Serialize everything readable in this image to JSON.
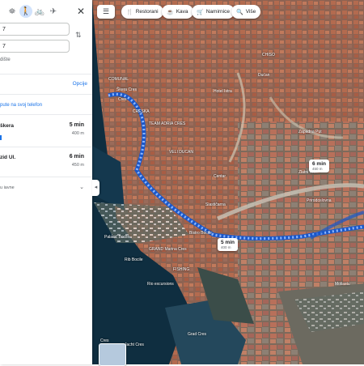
{
  "panel": {
    "modes": [
      {
        "name": "best-icon",
        "glyph": "⛯"
      },
      {
        "name": "walk-icon",
        "glyph": "🚶"
      },
      {
        "name": "bike-icon",
        "glyph": "🚲"
      },
      {
        "name": "flight-icon",
        "glyph": "✈"
      }
    ],
    "close_glyph": "✕",
    "origin_value": "7",
    "destination_value": "7",
    "swap_glyph": "⇅",
    "add_destination": "dište",
    "options_label": "Opcije",
    "send_to_phone": "pute na svoj telefon",
    "routes": [
      {
        "name": "škera",
        "time": "5 min",
        "distance": "400 m"
      },
      {
        "name": "zid Ul.",
        "time": "6 min",
        "distance": "450 m"
      }
    ],
    "footer_text": "u iavne",
    "footer_chevron": "⌄",
    "collapse_glyph": "◂"
  },
  "map": {
    "menu_glyph": "☰",
    "chips": [
      {
        "icon": "🍴",
        "label": "Restorani"
      },
      {
        "icon": "☕",
        "label": "Kava"
      },
      {
        "icon": "🛒",
        "label": "Namirnice"
      },
      {
        "icon": "🔍",
        "label": "Više"
      }
    ],
    "labels": [
      "COMUNAL",
      "Cres",
      "TEAM ADRIA CRES",
      "CHISO",
      "Dućan",
      "CRESKA",
      "Škera Cres",
      "Hotel Istra",
      "VELI DUCAN",
      "Palacić Bocile",
      "GRAND Marina Cres",
      "Bistro Bocile",
      "Slastičarna",
      "Zlatni Kafe",
      "Rib Bocile",
      "Rio excursions",
      "FISHING",
      "Grad Cres",
      "Jacht Cres",
      "Cres",
      "Moliastu",
      "Prirodoslovna",
      "Centar",
      "Zapadna Put"
    ],
    "callouts": [
      {
        "time": "6 min",
        "distance": "450 m"
      },
      {
        "time": "5 min",
        "distance": "400 m"
      }
    ],
    "colors": {
      "route": "#4285f4",
      "water": "#0e2a3c",
      "roof": "#a2624a"
    }
  }
}
